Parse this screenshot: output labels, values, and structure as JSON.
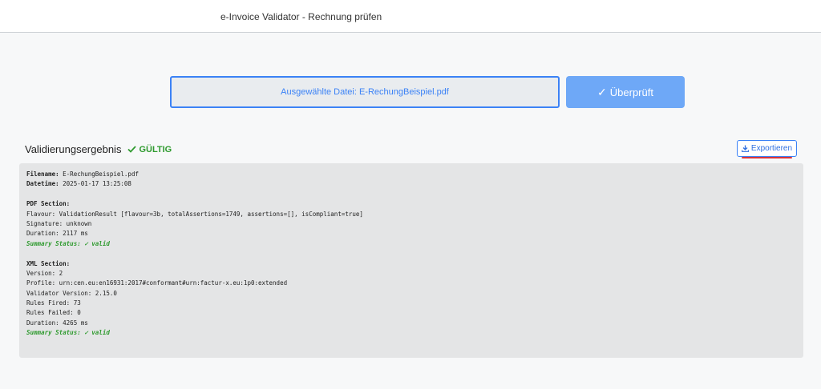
{
  "header": {
    "title": "e-Invoice Validator - Rechnung prüfen"
  },
  "upload": {
    "selected_file_text": "Ausgewählte Datei: E-RechungBeispiel.pdf",
    "verify_button_label": "Überprüft"
  },
  "result": {
    "title": "Validierungsergebnis",
    "status": "GÜLTIG",
    "export_label": "Exportieren"
  },
  "report": {
    "filename_key": "Filename:",
    "filename_val": " E-RechungBeispiel.pdf",
    "datetime_key": "Datetime:",
    "datetime_val": " 2025-01-17 13:25:08",
    "pdf_section": "PDF Section:",
    "pdf_flavour": "Flavour: ValidationResult [flavour=3b, totalAssertions=1749, assertions=[], isCompliant=true]",
    "pdf_signature": "Signature: unknown",
    "pdf_duration": "Duration: 2117 ms",
    "pdf_summary": "Summary Status: ✓ valid",
    "xml_section": "XML Section:",
    "xml_version": "Version: 2",
    "xml_profile": "Profile: urn:cen.eu:en16931:2017#conformant#urn:factur-x.eu:1p0:extended",
    "xml_validator": "Validator Version: 2.15.0",
    "xml_fired": "Rules Fired: 73",
    "xml_failed": "Rules Failed: 0",
    "xml_duration": "Duration: 4265 ms",
    "xml_summary": "Summary Status: ✓ valid"
  },
  "colors": {
    "accent": "#3b82f6",
    "button": "#6ea8f7",
    "success": "#2e9a2e"
  },
  "icons": {
    "verify": "check-icon",
    "status": "check-icon",
    "export": "download-icon"
  }
}
